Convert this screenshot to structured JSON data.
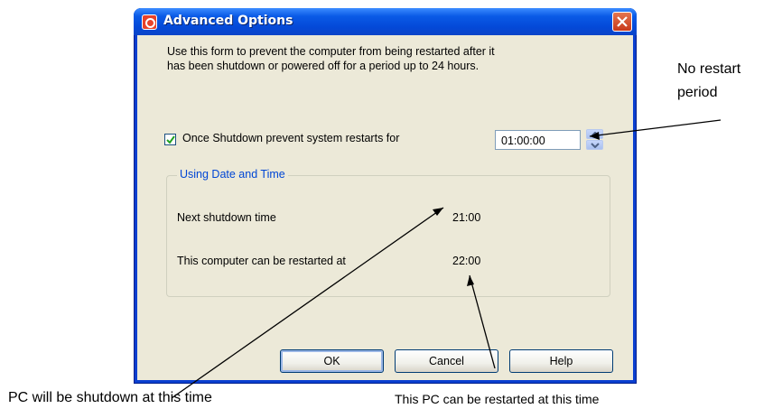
{
  "window": {
    "title": "Advanced Options",
    "description_line1": "Use this form to prevent the computer from being restarted after it",
    "description_line2": "has been shutdown or powered off for a period up to 24 hours."
  },
  "option": {
    "checkbox_checked": true,
    "checkbox_label": "Once Shutdown prevent system restarts for",
    "time_value": "01:00:00"
  },
  "group": {
    "title": "Using Date and Time",
    "next_shutdown_label": "Next shutdown time",
    "next_shutdown_value": "21:00",
    "restart_label": "This computer can be restarted at",
    "restart_value": "22:00"
  },
  "buttons": {
    "ok": "OK",
    "cancel": "Cancel",
    "help": "Help"
  },
  "annotations": {
    "no_restart_line1": "No restart",
    "no_restart_line2": "period",
    "shutdown_note": "PC will be shutdown at this time",
    "restart_note": "This PC can be restarted at this time"
  },
  "icons": {
    "app": "power-icon",
    "close": "close-icon",
    "spin_up": "arrow-up-icon",
    "spin_down": "arrow-down-icon",
    "check": "checkmark-icon"
  },
  "colors": {
    "titlebar": "#0a5ae6",
    "client": "#ece9d8",
    "group_title": "#0046d5",
    "close_button": "#d9552e"
  }
}
